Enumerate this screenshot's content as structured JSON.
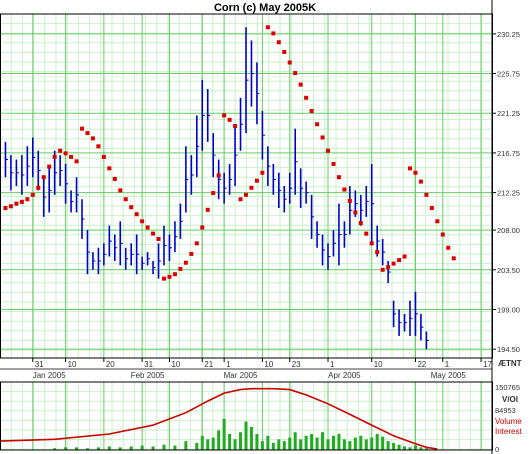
{
  "chart_data": {
    "type": "line",
    "title": "Corn (c) May 2005K",
    "price_panel": {
      "ylim": [
        193.5,
        232.5
      ],
      "y_ticks": [
        "230.25",
        "225.75",
        "221.25",
        "216.75",
        "212.25",
        "208.00",
        "203.50",
        "199.00",
        "194.50"
      ],
      "grid": true,
      "bars": [
        {
          "x": 1,
          "lo": 214.0,
          "hi": 218.0
        },
        {
          "x": 2,
          "lo": 212.5,
          "hi": 216.5
        },
        {
          "x": 3,
          "lo": 213.0,
          "hi": 216.0
        },
        {
          "x": 4,
          "lo": 212.0,
          "hi": 216.5
        },
        {
          "x": 5,
          "lo": 213.0,
          "hi": 217.5
        },
        {
          "x": 6,
          "lo": 214.0,
          "hi": 218.5
        },
        {
          "x": 7,
          "lo": 212.5,
          "hi": 217.0
        },
        {
          "x": 8,
          "lo": 209.5,
          "hi": 214.0
        },
        {
          "x": 9,
          "lo": 210.0,
          "hi": 215.0
        },
        {
          "x": 10,
          "lo": 212.0,
          "hi": 217.0
        },
        {
          "x": 11,
          "lo": 213.0,
          "hi": 216.5
        },
        {
          "x": 12,
          "lo": 211.0,
          "hi": 215.5
        },
        {
          "x": 13,
          "lo": 210.0,
          "hi": 212.5
        },
        {
          "x": 14,
          "lo": 210.0,
          "hi": 214.0
        },
        {
          "x": 15,
          "lo": 207.0,
          "hi": 211.5
        },
        {
          "x": 16,
          "lo": 203.0,
          "hi": 208.0
        },
        {
          "x": 17,
          "lo": 203.5,
          "hi": 205.5
        },
        {
          "x": 18,
          "lo": 203.0,
          "hi": 206.0
        },
        {
          "x": 19,
          "lo": 204.0,
          "hi": 206.5
        },
        {
          "x": 20,
          "lo": 205.0,
          "hi": 208.5
        },
        {
          "x": 21,
          "lo": 204.5,
          "hi": 207.5
        },
        {
          "x": 22,
          "lo": 204.0,
          "hi": 209.0
        },
        {
          "x": 23,
          "lo": 203.5,
          "hi": 206.0
        },
        {
          "x": 24,
          "lo": 204.0,
          "hi": 206.5
        },
        {
          "x": 25,
          "lo": 203.0,
          "hi": 207.5
        },
        {
          "x": 26,
          "lo": 203.5,
          "hi": 205.0
        },
        {
          "x": 27,
          "lo": 204.0,
          "hi": 205.5
        },
        {
          "x": 28,
          "lo": 203.0,
          "hi": 204.5
        },
        {
          "x": 29,
          "lo": 202.5,
          "hi": 206.5
        },
        {
          "x": 30,
          "lo": 204.0,
          "hi": 208.5
        },
        {
          "x": 31,
          "lo": 204.5,
          "hi": 207.5
        },
        {
          "x": 32,
          "lo": 205.5,
          "hi": 209.0
        },
        {
          "x": 33,
          "lo": 207.0,
          "hi": 211.0
        },
        {
          "x": 34,
          "lo": 210.0,
          "hi": 217.5
        },
        {
          "x": 35,
          "lo": 212.0,
          "hi": 216.5
        },
        {
          "x": 36,
          "lo": 214.0,
          "hi": 221.0
        },
        {
          "x": 37,
          "lo": 217.0,
          "hi": 225.0
        },
        {
          "x": 38,
          "lo": 218.0,
          "hi": 224.0
        },
        {
          "x": 39,
          "lo": 214.0,
          "hi": 219.0
        },
        {
          "x": 40,
          "lo": 211.5,
          "hi": 216.0
        },
        {
          "x": 41,
          "lo": 211.0,
          "hi": 214.5
        },
        {
          "x": 42,
          "lo": 212.0,
          "hi": 215.5
        },
        {
          "x": 43,
          "lo": 213.0,
          "hi": 220.0
        },
        {
          "x": 44,
          "lo": 217.0,
          "hi": 223.0
        },
        {
          "x": 45,
          "lo": 219.0,
          "hi": 231.0
        },
        {
          "x": 46,
          "lo": 222.0,
          "hi": 229.5
        },
        {
          "x": 47,
          "lo": 220.0,
          "hi": 227.0
        },
        {
          "x": 48,
          "lo": 216.0,
          "hi": 221.5
        },
        {
          "x": 49,
          "lo": 213.0,
          "hi": 217.5
        },
        {
          "x": 50,
          "lo": 212.0,
          "hi": 215.5
        },
        {
          "x": 51,
          "lo": 210.5,
          "hi": 214.5
        },
        {
          "x": 52,
          "lo": 210.0,
          "hi": 213.0
        },
        {
          "x": 53,
          "lo": 211.0,
          "hi": 214.5
        },
        {
          "x": 54,
          "lo": 212.0,
          "hi": 219.5
        },
        {
          "x": 55,
          "lo": 210.5,
          "hi": 215.0
        },
        {
          "x": 56,
          "lo": 211.0,
          "hi": 213.5
        },
        {
          "x": 57,
          "lo": 207.0,
          "hi": 212.0
        },
        {
          "x": 58,
          "lo": 206.0,
          "hi": 209.0
        },
        {
          "x": 59,
          "lo": 204.0,
          "hi": 207.5
        },
        {
          "x": 60,
          "lo": 203.5,
          "hi": 206.5
        },
        {
          "x": 61,
          "lo": 205.0,
          "hi": 208.0
        },
        {
          "x": 62,
          "lo": 204.0,
          "hi": 211.0
        },
        {
          "x": 63,
          "lo": 206.0,
          "hi": 209.0
        },
        {
          "x": 64,
          "lo": 207.5,
          "hi": 213.0
        },
        {
          "x": 65,
          "lo": 209.5,
          "hi": 212.5
        },
        {
          "x": 66,
          "lo": 208.5,
          "hi": 212.0
        },
        {
          "x": 67,
          "lo": 209.5,
          "hi": 213.0
        },
        {
          "x": 68,
          "lo": 206.5,
          "hi": 215.5
        },
        {
          "x": 69,
          "lo": 205.0,
          "hi": 208.5
        },
        {
          "x": 70,
          "lo": 204.0,
          "hi": 207.0
        },
        {
          "x": 71,
          "lo": 202.0,
          "hi": 204.5
        },
        {
          "x": 72,
          "lo": 197.0,
          "hi": 200.0
        },
        {
          "x": 73,
          "lo": 196.0,
          "hi": 199.0
        },
        {
          "x": 74,
          "lo": 196.5,
          "hi": 198.5
        },
        {
          "x": 75,
          "lo": 196.0,
          "hi": 200.0
        },
        {
          "x": 76,
          "lo": 196.0,
          "hi": 201.0
        },
        {
          "x": 77,
          "lo": 195.5,
          "hi": 198.5
        },
        {
          "x": 78,
          "lo": 194.5,
          "hi": 196.5
        }
      ],
      "sar": [
        {
          "x": 1,
          "y": 210.5
        },
        {
          "x": 2,
          "y": 210.7
        },
        {
          "x": 3,
          "y": 211.0
        },
        {
          "x": 4,
          "y": 211.2
        },
        {
          "x": 5,
          "y": 211.5
        },
        {
          "x": 6,
          "y": 212.0
        },
        {
          "x": 7,
          "y": 212.8
        },
        {
          "x": 8,
          "y": 214.0
        },
        {
          "x": 9,
          "y": 215.2
        },
        {
          "x": 10,
          "y": 216.3
        },
        {
          "x": 11,
          "y": 217.0
        },
        {
          "x": 12,
          "y": 216.7
        },
        {
          "x": 13,
          "y": 216.3
        },
        {
          "x": 14,
          "y": 215.8
        },
        {
          "x": 15,
          "y": 219.5
        },
        {
          "x": 16,
          "y": 219.0
        },
        {
          "x": 17,
          "y": 218.4
        },
        {
          "x": 18,
          "y": 217.5
        },
        {
          "x": 19,
          "y": 216.3
        },
        {
          "x": 20,
          "y": 215.0
        },
        {
          "x": 21,
          "y": 213.8
        },
        {
          "x": 22,
          "y": 212.5
        },
        {
          "x": 23,
          "y": 211.5
        },
        {
          "x": 24,
          "y": 210.6
        },
        {
          "x": 25,
          "y": 209.8
        },
        {
          "x": 26,
          "y": 209.0
        },
        {
          "x": 27,
          "y": 208.3
        },
        {
          "x": 28,
          "y": 207.6
        },
        {
          "x": 29,
          "y": 207.0
        },
        {
          "x": 30,
          "y": 202.5
        },
        {
          "x": 31,
          "y": 202.7
        },
        {
          "x": 32,
          "y": 203.0
        },
        {
          "x": 33,
          "y": 203.6
        },
        {
          "x": 34,
          "y": 204.3
        },
        {
          "x": 35,
          "y": 205.3
        },
        {
          "x": 36,
          "y": 206.5
        },
        {
          "x": 37,
          "y": 208.3
        },
        {
          "x": 38,
          "y": 210.3
        },
        {
          "x": 39,
          "y": 212.2
        },
        {
          "x": 40,
          "y": 214.2
        },
        {
          "x": 41,
          "y": 221.0
        },
        {
          "x": 42,
          "y": 220.5
        },
        {
          "x": 43,
          "y": 219.8
        },
        {
          "x": 44,
          "y": 211.5
        },
        {
          "x": 45,
          "y": 212.0
        },
        {
          "x": 46,
          "y": 212.8
        },
        {
          "x": 47,
          "y": 213.6
        },
        {
          "x": 48,
          "y": 214.5
        },
        {
          "x": 49,
          "y": 231.0
        },
        {
          "x": 50,
          "y": 230.3
        },
        {
          "x": 51,
          "y": 229.3
        },
        {
          "x": 52,
          "y": 228.2
        },
        {
          "x": 53,
          "y": 227.0
        },
        {
          "x": 54,
          "y": 225.8
        },
        {
          "x": 55,
          "y": 224.5
        },
        {
          "x": 56,
          "y": 223.0
        },
        {
          "x": 57,
          "y": 221.5
        },
        {
          "x": 58,
          "y": 220.0
        },
        {
          "x": 59,
          "y": 218.5
        },
        {
          "x": 60,
          "y": 217.0
        },
        {
          "x": 61,
          "y": 215.5
        },
        {
          "x": 62,
          "y": 214.0
        },
        {
          "x": 63,
          "y": 212.6
        },
        {
          "x": 64,
          "y": 211.3
        },
        {
          "x": 65,
          "y": 210.0
        },
        {
          "x": 66,
          "y": 208.8
        },
        {
          "x": 67,
          "y": 207.6
        },
        {
          "x": 68,
          "y": 206.5
        },
        {
          "x": 69,
          "y": 205.5
        },
        {
          "x": 70,
          "y": 203.5
        },
        {
          "x": 71,
          "y": 203.8
        },
        {
          "x": 72,
          "y": 204.2
        },
        {
          "x": 73,
          "y": 204.6
        },
        {
          "x": 74,
          "y": 205.0
        },
        {
          "x": 75,
          "y": 215.0
        },
        {
          "x": 76,
          "y": 214.5
        },
        {
          "x": 77,
          "y": 213.5
        },
        {
          "x": 78,
          "y": 212.0
        },
        {
          "x": 79,
          "y": 210.5
        },
        {
          "x": 80,
          "y": 209.0
        },
        {
          "x": 81,
          "y": 207.5
        },
        {
          "x": 82,
          "y": 206.0
        },
        {
          "x": 83,
          "y": 204.8
        }
      ],
      "bar_color": "#0000cc",
      "sar_color": "#dd0000"
    },
    "date_axis": {
      "upper_ticks": [
        {
          "x": 6,
          "label": "31"
        },
        {
          "x": 12,
          "label": "10"
        },
        {
          "x": 19,
          "label": "20"
        },
        {
          "x": 26,
          "label": "31"
        },
        {
          "x": 31,
          "label": "10"
        },
        {
          "x": 37,
          "label": "21"
        },
        {
          "x": 41,
          "label": "1"
        },
        {
          "x": 48,
          "label": "10"
        },
        {
          "x": 53,
          "label": "23"
        },
        {
          "x": 60,
          "label": "1"
        },
        {
          "x": 68,
          "label": "10"
        },
        {
          "x": 76,
          "label": "22"
        },
        {
          "x": 81,
          "label": "1"
        },
        {
          "x": 88,
          "label": "17"
        }
      ],
      "lower_ticks": [
        {
          "x": 9,
          "label": "Jan 2005"
        },
        {
          "x": 27,
          "label": "Feb 2005"
        },
        {
          "x": 44,
          "label": "Mar 2005"
        },
        {
          "x": 63,
          "label": "Apr 2005"
        },
        {
          "x": 82,
          "label": "May 2005"
        }
      ]
    },
    "volume_panel": {
      "right_labels": {
        "top": "150765",
        "mid": "V/OI",
        "low": "84953",
        "bottom": "0"
      },
      "legend": [
        "Volume",
        "Interest"
      ],
      "volume": [
        {
          "x": 10,
          "v": 2
        },
        {
          "x": 12,
          "v": 3
        },
        {
          "x": 14,
          "v": 3
        },
        {
          "x": 16,
          "v": 2
        },
        {
          "x": 18,
          "v": 3
        },
        {
          "x": 20,
          "v": 4
        },
        {
          "x": 22,
          "v": 3
        },
        {
          "x": 24,
          "v": 4
        },
        {
          "x": 26,
          "v": 5
        },
        {
          "x": 28,
          "v": 4
        },
        {
          "x": 30,
          "v": 6
        },
        {
          "x": 32,
          "v": 5
        },
        {
          "x": 34,
          "v": 10
        },
        {
          "x": 36,
          "v": 8
        },
        {
          "x": 37,
          "v": 16
        },
        {
          "x": 38,
          "v": 12
        },
        {
          "x": 39,
          "v": 14
        },
        {
          "x": 40,
          "v": 22
        },
        {
          "x": 41,
          "v": 35
        },
        {
          "x": 42,
          "v": 18
        },
        {
          "x": 43,
          "v": 12
        },
        {
          "x": 44,
          "v": 20
        },
        {
          "x": 45,
          "v": 32
        },
        {
          "x": 46,
          "v": 26
        },
        {
          "x": 47,
          "v": 18
        },
        {
          "x": 48,
          "v": 10
        },
        {
          "x": 49,
          "v": 16
        },
        {
          "x": 50,
          "v": 8
        },
        {
          "x": 51,
          "v": 12
        },
        {
          "x": 52,
          "v": 10
        },
        {
          "x": 53,
          "v": 14
        },
        {
          "x": 54,
          "v": 20
        },
        {
          "x": 55,
          "v": 12
        },
        {
          "x": 56,
          "v": 16
        },
        {
          "x": 57,
          "v": 18
        },
        {
          "x": 58,
          "v": 14
        },
        {
          "x": 59,
          "v": 20
        },
        {
          "x": 60,
          "v": 12
        },
        {
          "x": 61,
          "v": 16
        },
        {
          "x": 62,
          "v": 18
        },
        {
          "x": 63,
          "v": 12
        },
        {
          "x": 64,
          "v": 10
        },
        {
          "x": 65,
          "v": 14
        },
        {
          "x": 66,
          "v": 16
        },
        {
          "x": 67,
          "v": 12
        },
        {
          "x": 68,
          "v": 14
        },
        {
          "x": 69,
          "v": 18
        },
        {
          "x": 70,
          "v": 15
        },
        {
          "x": 71,
          "v": 10
        },
        {
          "x": 72,
          "v": 8
        },
        {
          "x": 73,
          "v": 6
        },
        {
          "x": 74,
          "v": 4
        },
        {
          "x": 75,
          "v": 3
        },
        {
          "x": 76,
          "v": 5
        },
        {
          "x": 77,
          "v": 3
        },
        {
          "x": 78,
          "v": 2
        }
      ],
      "interest": [
        {
          "x": 0,
          "v": 10
        },
        {
          "x": 10,
          "v": 12
        },
        {
          "x": 20,
          "v": 18
        },
        {
          "x": 28,
          "v": 28
        },
        {
          "x": 34,
          "v": 42
        },
        {
          "x": 38,
          "v": 55
        },
        {
          "x": 41,
          "v": 64
        },
        {
          "x": 44,
          "v": 68
        },
        {
          "x": 46,
          "v": 69
        },
        {
          "x": 50,
          "v": 69
        },
        {
          "x": 53,
          "v": 68
        },
        {
          "x": 56,
          "v": 62
        },
        {
          "x": 60,
          "v": 52
        },
        {
          "x": 64,
          "v": 40
        },
        {
          "x": 68,
          "v": 28
        },
        {
          "x": 72,
          "v": 16
        },
        {
          "x": 76,
          "v": 7
        },
        {
          "x": 78,
          "v": 3
        },
        {
          "x": 80,
          "v": 1
        }
      ],
      "volume_color": "#22aa22",
      "interest_color": "#cc0000"
    },
    "watermark": "ÆTNT"
  }
}
